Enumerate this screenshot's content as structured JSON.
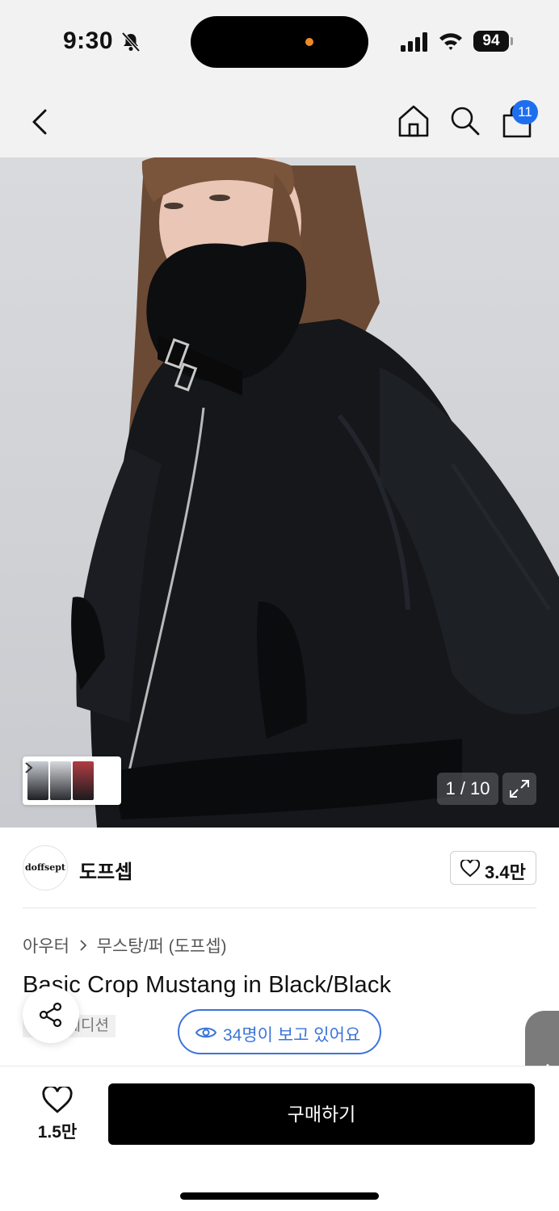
{
  "status_bar": {
    "time": "9:30",
    "battery": "94",
    "icons": [
      "bell-slash-icon",
      "signal-icon",
      "wifi-icon",
      "battery-icon"
    ]
  },
  "nav": {
    "icons": [
      "back-chevron-icon",
      "home-icon",
      "search-icon",
      "shopping-bag-icon"
    ],
    "cart_badge": "11"
  },
  "gallery": {
    "counter": "1 / 10",
    "expand_icon": "expand-icon"
  },
  "brand": {
    "logo_text": "doffsept",
    "name": "도프셉",
    "like_count": "3.4만"
  },
  "product": {
    "breadcrumb": [
      "아우터",
      "무스탕/퍼 (도프셉)"
    ],
    "title": "Basic Crop Mustang in Black/Black",
    "tag": "에디션",
    "viewers": "34명이 보고 있어요"
  },
  "bottom": {
    "wish_count": "1.5만",
    "buy_label": "구매하기"
  },
  "colors": {
    "accent_blue": "#3b74d8",
    "badge_blue": "#1e6ff0",
    "buy_bg": "#000000"
  }
}
